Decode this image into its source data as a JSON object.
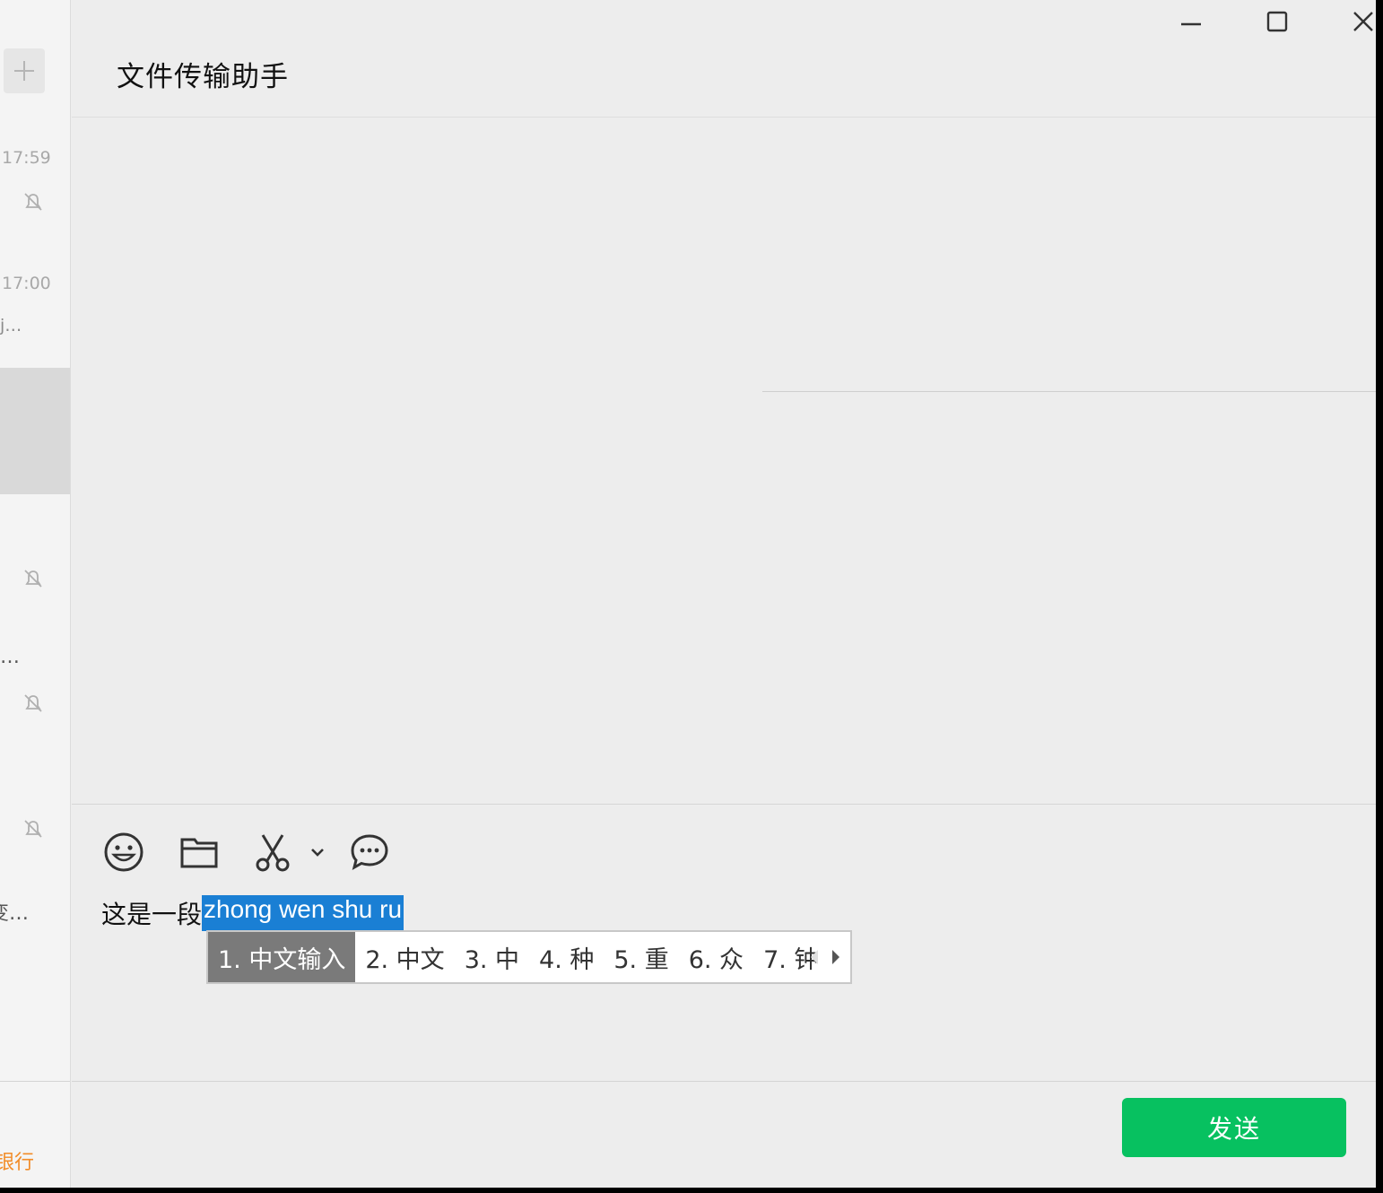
{
  "window": {
    "title": "文件传输助手",
    "controls": [
      "minimize-icon",
      "maximize-icon",
      "close-icon"
    ]
  },
  "sidebar": {
    "add_icon": "plus-icon",
    "items": [
      {
        "time": "17:59",
        "snippet": "",
        "muted": true
      },
      {
        "time": "17:00",
        "snippet": "j…",
        "muted": false
      },
      {
        "time": "",
        "snippet": "",
        "selected": true
      },
      {
        "time": "",
        "snippet": "",
        "muted": true
      },
      {
        "time": "",
        "snippet": "…",
        "muted": true
      },
      {
        "time": "",
        "snippet": "",
        "muted": true
      },
      {
        "time": "",
        "snippet": "变…",
        "muted": false
      }
    ],
    "bottom_text": "银行"
  },
  "toolbar": {
    "icons": [
      "emoji-icon",
      "folder-icon",
      "scissors-icon",
      "chevron-down-icon",
      "chat-bubble-icon"
    ]
  },
  "compose": {
    "committed_text": "这是一段",
    "preedit_text": "zhong wen shu ru"
  },
  "ime": {
    "candidates": [
      "1. 中文输入",
      "2. 中文",
      "3. 中",
      "4. 种",
      "5. 重",
      "6. 众",
      "7. 钟"
    ],
    "selected_index": 0
  },
  "send_button": {
    "label": "发送"
  },
  "colors": {
    "accent_green": "#07c160",
    "preedit_highlight": "#1a7fd4",
    "candidate_selected": "#7a7a7a",
    "sidebar_highlight": "#f28c28"
  }
}
